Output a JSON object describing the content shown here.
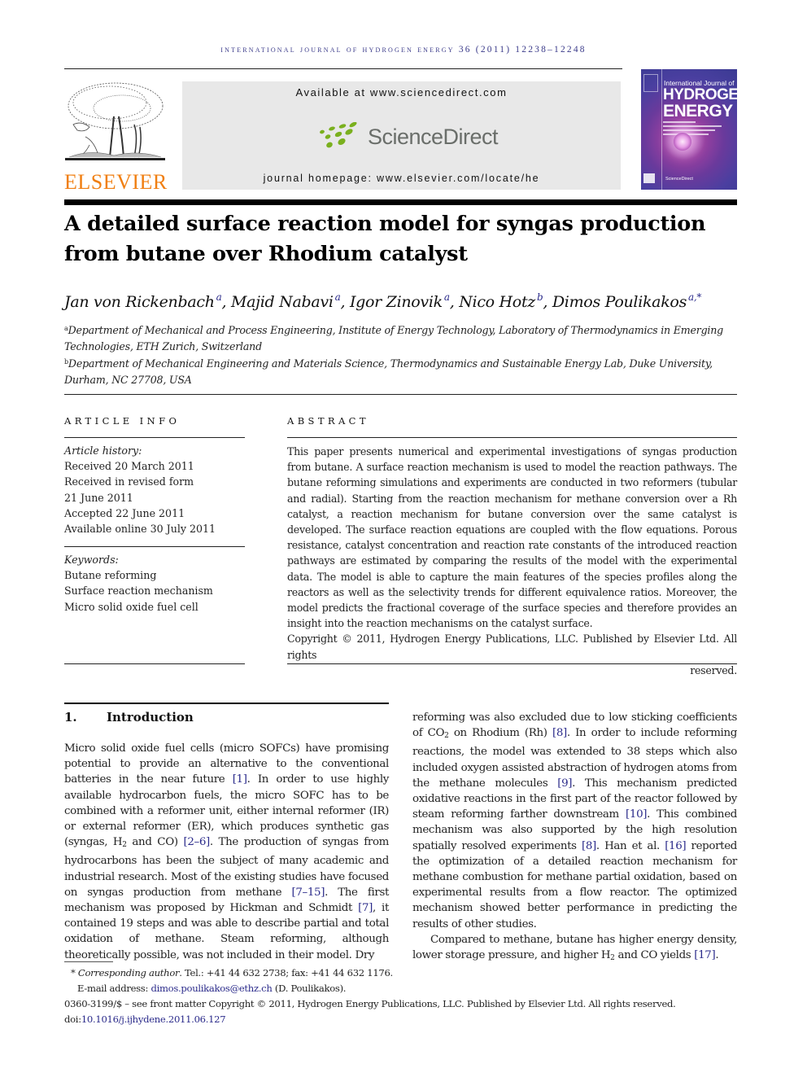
{
  "running_head": "International Journal of Hydrogen Energy 36 (2011) 12238–12248",
  "masthead": {
    "publisher_logo": "ELSEVIER",
    "available_at": "Available at www.sciencedirect.com",
    "sciencedirect_logo": "ScienceDirect",
    "journal_homepage": "journal homepage: www.elsevier.com/locate/he",
    "cover": {
      "line1": "International Journal of",
      "line2": "HYDROGEN",
      "line3": "ENERGY",
      "footer": "ScienceDirect"
    },
    "colors": {
      "elsevier_orange": "#f07f12",
      "sciencedirect_green": "#7ab01e",
      "link_blue": "#2a2a8a"
    }
  },
  "article": {
    "title": "A detailed surface reaction model for syngas production from butane over Rhodium catalyst",
    "authors": [
      {
        "name": "Jan von Rickenbach",
        "affil": "a"
      },
      {
        "name": "Majid Nabavi",
        "affil": "a"
      },
      {
        "name": "Igor Zinovik",
        "affil": "a"
      },
      {
        "name": "Nico Hotz",
        "affil": "b"
      },
      {
        "name": "Dimos Poulikakos",
        "affil": "a,*"
      }
    ],
    "affiliations": [
      {
        "mark": "a",
        "text": "Department of Mechanical and Process Engineering, Institute of Energy Technology, Laboratory of Thermodynamics in Emerging Technologies, ETH Zurich, Switzerland"
      },
      {
        "mark": "b",
        "text": "Department of Mechanical Engineering and Materials Science, Thermodynamics and Sustainable Energy Lab, Duke University, Durham, NC 27708, USA"
      }
    ]
  },
  "article_info": {
    "heading": "ARTICLE INFO",
    "history_label": "Article history:",
    "history": [
      "Received 20 March 2011",
      "Received in revised form",
      "21 June 2011",
      "Accepted 22 June 2011",
      "Available online 30 July 2011"
    ],
    "keywords_label": "Keywords:",
    "keywords": [
      "Butane reforming",
      "Surface reaction mechanism",
      "Micro solid oxide fuel cell"
    ]
  },
  "abstract": {
    "heading": "ABSTRACT",
    "text": "This paper presents numerical and experimental investigations of syngas production from butane. A surface reaction mechanism is used to model the reaction pathways. The butane reforming simulations and experiments are conducted in two reformers (tubular and radial). Starting from the reaction mechanism for methane conversion over a Rh catalyst, a reaction mechanism for butane conversion over the same catalyst is developed. The surface reaction equations are coupled with the flow equations. Porous resistance, catalyst concentration and reaction rate constants of the introduced reaction pathways are esti­mated by comparing the results of the model with the experimental data. The model is able to capture the main features of the species profiles along the reactors as well as the selectivity trends for different equivalence ratios. Moreover, the model predicts the frac­tional coverage of the surface species and therefore provides an insight into the reaction mechanisms on the catalyst surface.",
    "copyright_line1": "Copyright © 2011, Hydrogen Energy Publications, LLC. Published by Elsevier Ltd. All rights",
    "copyright_line2": "reserved."
  },
  "introduction": {
    "number": "1.",
    "heading": "Introduction",
    "left_col": {
      "s1": "Micro solid oxide fuel cells (micro SOFCs) have promising potential to provide an alternative to the conventional batteries in the near future ",
      "r1": "[1]",
      "s2": ". In order to use highly available hydro­carbon fuels, the micro SOFC has to be combined with a reformer unit, either internal reformer (IR) or external reformer (ER), which produces synthetic gas (syngas, H",
      "sub2": "2",
      "s3": " and CO) ",
      "r2": "[2–6]",
      "s4": ". The production of syngas from hydrocarbons has been the subject of many academic and industrial research. Most of the existing studies have focused on syngas production from methane ",
      "r3": "[7–15]",
      "s5": ". The first mechanism was proposed by Hickman and Schmidt ",
      "r4": "[7]",
      "s6": ", it contained 19 steps and was able to describe partial and total oxidation of methane. Steam reforming, although theoretically possible, was not included in their model. Dry"
    },
    "right_col": {
      "s1": "reforming was also excluded due to low sticking coefficients of CO",
      "sub1": "2",
      "s2": " on Rhodium (Rh) ",
      "r1": "[8]",
      "s3": ". In order to include reforming reactions, the model was extended to 38 steps which also included oxygen assisted abstraction of hydrogen atoms from the methane molecules ",
      "r2": "[9]",
      "s4": ". This mechanism predicted oxidative reactions in the first part of the reactor followed by steam reforming farther downstream ",
      "r3": "[10]",
      "s5": ". This combined mechanism was also sup­ported by the high resolution spatially resolved experiments ",
      "r4": "[8]",
      "s6": ". Han et al. ",
      "r5": "[16]",
      "s7": " reported the optimization of a detailed reaction mechanism for methane combustion for methane partial oxidation, based on experimental results from a flow reactor. The optimized mechanism showed better performance in pre­dicting the results of other studies.",
      "p2_s1": "Compared to methane, butane has higher energy density, lower storage pressure, and higher H",
      "p2_sub": "2",
      "p2_s2": " and CO yields ",
      "p2_r1": "[17]",
      "p2_s3": "."
    }
  },
  "footnotes": {
    "star": "*",
    "corresponding_label": "Corresponding author",
    "contact": ". Tel.: +41 44 632 2738; fax: +41 44 632 1176.",
    "email_label": "E-mail address: ",
    "email": "dimos.poulikakos@ethz.ch",
    "email_suffix": " (D. Poulikakos).",
    "issn_line": "0360-3199/$ – see front matter Copyright © 2011, Hydrogen Energy Publications, LLC. Published by Elsevier Ltd. All rights reserved.",
    "doi_label": "doi:",
    "doi": "10.1016/j.ijhydene.2011.06.127"
  }
}
